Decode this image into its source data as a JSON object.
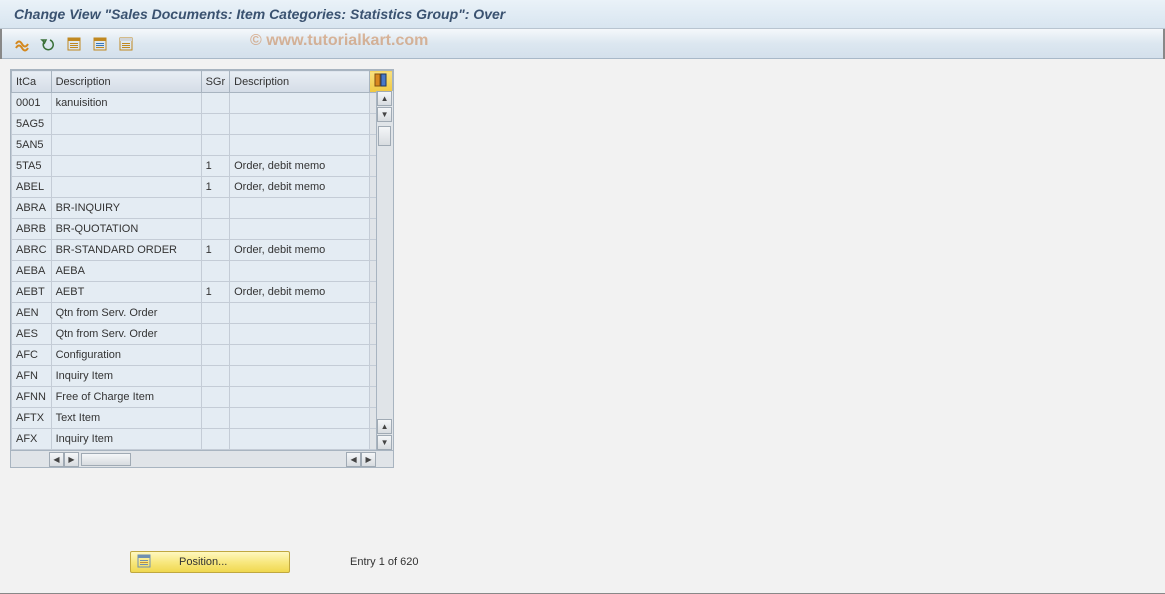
{
  "title": "Change View \"Sales Documents: Item Categories: Statistics Group\": Over",
  "watermark": "© www.tutorialkart.com",
  "toolbar": {
    "btn1": "change-other-view",
    "btn2": "undo",
    "btn3": "select-all",
    "btn4": "select-block",
    "btn5": "deselect-all"
  },
  "table": {
    "headers": {
      "itca": "ItCa",
      "desc": "Description",
      "sgr": "SGr",
      "desc2": "Description"
    },
    "rows": [
      {
        "itca": "0001",
        "desc": "kanuisition",
        "sgr": "",
        "desc2": ""
      },
      {
        "itca": "5AG5",
        "desc": "",
        "sgr": "",
        "desc2": ""
      },
      {
        "itca": "5AN5",
        "desc": "",
        "sgr": "",
        "desc2": ""
      },
      {
        "itca": "5TA5",
        "desc": "",
        "sgr": "1",
        "desc2": "Order, debit memo"
      },
      {
        "itca": "ABEL",
        "desc": "",
        "sgr": "1",
        "desc2": "Order, debit memo"
      },
      {
        "itca": "ABRA",
        "desc": "BR-INQUIRY",
        "sgr": "",
        "desc2": ""
      },
      {
        "itca": "ABRB",
        "desc": "BR-QUOTATION",
        "sgr": "",
        "desc2": ""
      },
      {
        "itca": "ABRC",
        "desc": "BR-STANDARD ORDER",
        "sgr": "1",
        "desc2": "Order, debit memo"
      },
      {
        "itca": "AEBA",
        "desc": "AEBA",
        "sgr": "",
        "desc2": ""
      },
      {
        "itca": "AEBT",
        "desc": "AEBT",
        "sgr": "1",
        "desc2": "Order, debit memo"
      },
      {
        "itca": "AEN",
        "desc": "Qtn from Serv. Order",
        "sgr": "",
        "desc2": ""
      },
      {
        "itca": "AES",
        "desc": "Qtn from Serv. Order",
        "sgr": "",
        "desc2": ""
      },
      {
        "itca": "AFC",
        "desc": "Configuration",
        "sgr": "",
        "desc2": ""
      },
      {
        "itca": "AFN",
        "desc": "Inquiry Item",
        "sgr": "",
        "desc2": ""
      },
      {
        "itca": "AFNN",
        "desc": "Free of Charge Item",
        "sgr": "",
        "desc2": ""
      },
      {
        "itca": "AFTX",
        "desc": "Text Item",
        "sgr": "",
        "desc2": ""
      },
      {
        "itca": "AFX",
        "desc": "Inquiry Item",
        "sgr": "",
        "desc2": ""
      }
    ]
  },
  "footer": {
    "position_label": "Position...",
    "entry_text": "Entry 1 of 620"
  }
}
